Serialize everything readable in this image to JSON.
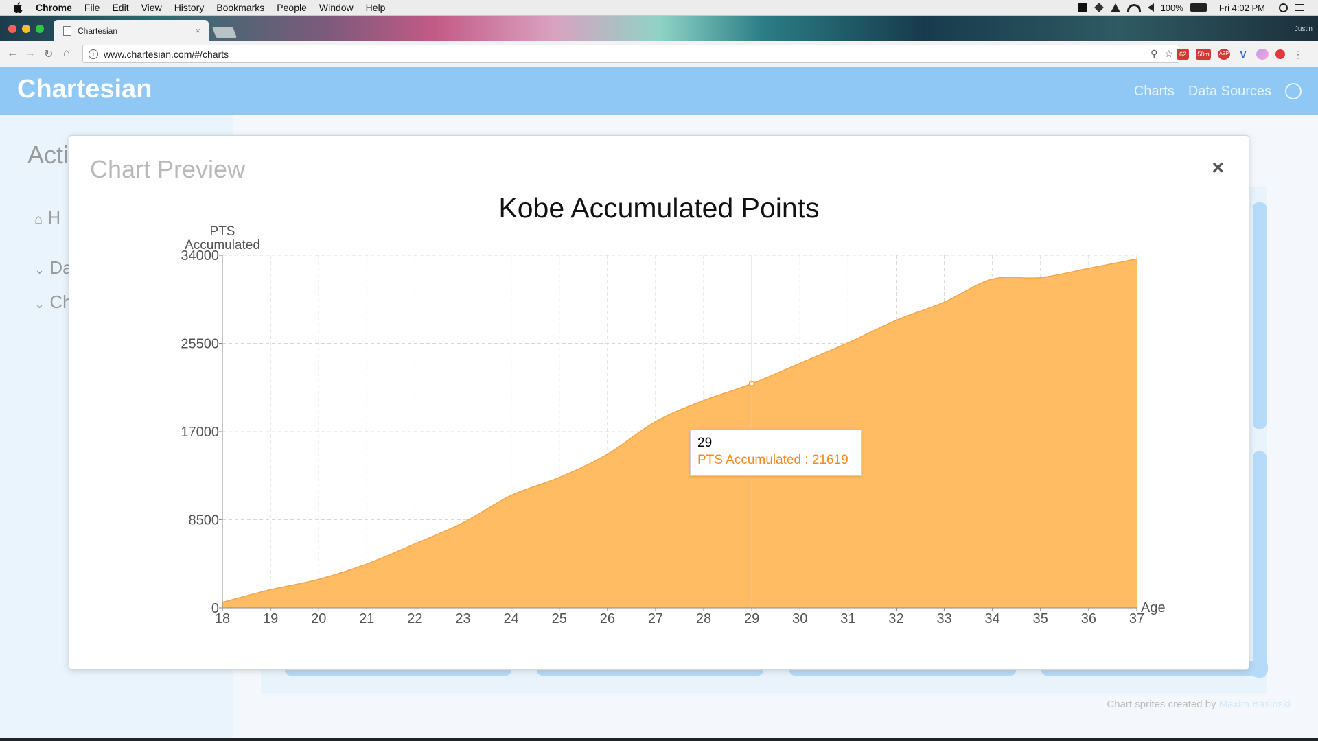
{
  "menubar": {
    "app": "Chrome",
    "items": [
      "File",
      "Edit",
      "View",
      "History",
      "Bookmarks",
      "People",
      "Window",
      "Help"
    ],
    "battery": "100%",
    "clock": "Fri 4:02 PM",
    "icons": [
      "evernote-icon",
      "dropbox-icon",
      "drive-icon",
      "wifi-icon",
      "volume-icon",
      "search-icon"
    ]
  },
  "browser": {
    "tab_title": "Chartesian",
    "url": "www.chartesian.com/#/charts",
    "profile": "Justin",
    "ext_badges": [
      "62",
      "58m",
      "ABP"
    ]
  },
  "app": {
    "brand": "Chartesian",
    "nav": [
      "Charts",
      "Data Sources"
    ]
  },
  "sidebar": {
    "title": "Acti",
    "items": [
      "H",
      "Da",
      "Ch"
    ]
  },
  "footer": {
    "credit": "Chart sprites created by",
    "author": "Maxim Basinski"
  },
  "modal": {
    "title": "Chart Preview",
    "close": "×"
  },
  "tooltip": {
    "x": "29",
    "label": "PTS Accumulated : 21619"
  },
  "colors": {
    "area_fill": "#ffbc63",
    "area_stroke": "#f5a54a",
    "header_bg": "#8fc8f5",
    "tooltip_value": "#f08a24"
  },
  "chart_data": {
    "type": "area",
    "title": "Kobe Accumulated Points",
    "ylabel_line1": "PTS",
    "ylabel_line2": "Accumulated",
    "xlabel": "Age",
    "x": [
      18,
      19,
      20,
      21,
      22,
      23,
      24,
      25,
      26,
      27,
      28,
      29,
      30,
      31,
      32,
      33,
      34,
      35,
      36,
      37
    ],
    "series": [
      {
        "name": "PTS Accumulated",
        "values": [
          539,
          1759,
          2755,
          4240,
          6180,
          8212,
          10851,
          12578,
          14819,
          17965,
          19995,
          21619,
          23589,
          25559,
          27732,
          29484,
          31700,
          31845,
          32741,
          33643
        ]
      }
    ],
    "yticks": [
      0,
      8500,
      17000,
      25500,
      34000
    ],
    "ylim": [
      0,
      34000
    ],
    "xlim": [
      18,
      37
    ],
    "grid": true,
    "highlighted_x": 29
  }
}
